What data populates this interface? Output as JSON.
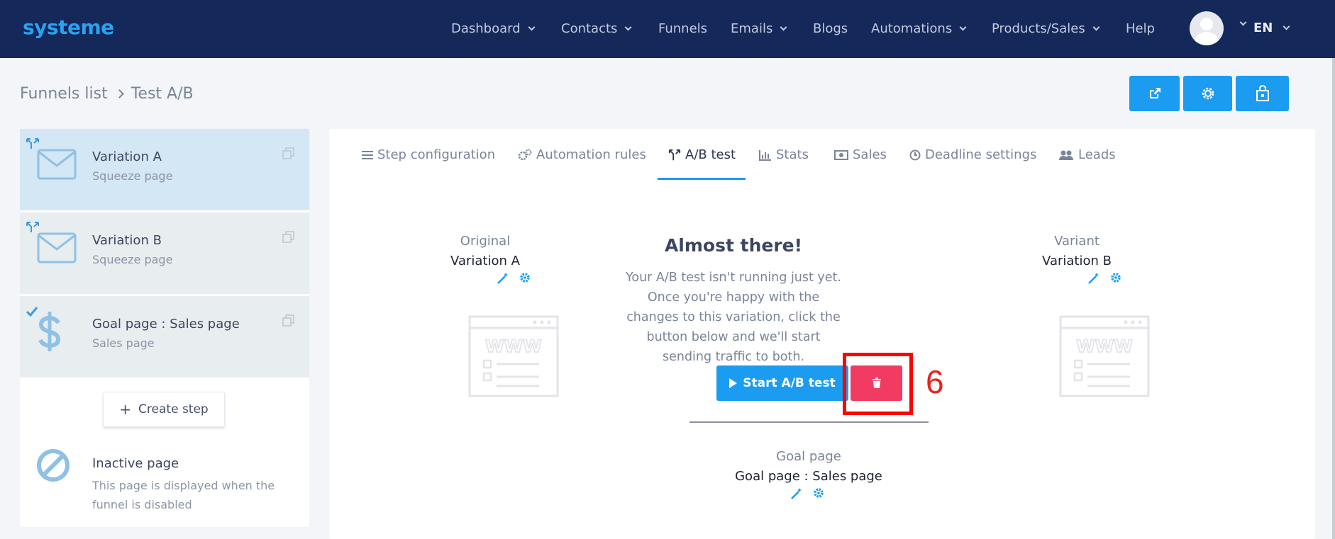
{
  "app": {
    "logo": "systeme"
  },
  "nav": {
    "items": [
      {
        "label": "Dashboard",
        "dropdown": true
      },
      {
        "label": "Contacts",
        "dropdown": true
      },
      {
        "label": "Funnels",
        "dropdown": false
      },
      {
        "label": "Emails",
        "dropdown": true
      },
      {
        "label": "Blogs",
        "dropdown": false
      },
      {
        "label": "Automations",
        "dropdown": true
      },
      {
        "label": "Products/Sales",
        "dropdown": true
      },
      {
        "label": "Help",
        "dropdown": false
      }
    ],
    "language": "EN"
  },
  "breadcrumb": {
    "parent": "Funnels list",
    "current": "Test A/B"
  },
  "top_actions": [
    "external-link-icon",
    "gear-icon",
    "shopping-bag-icon"
  ],
  "sidebar": {
    "steps": [
      {
        "title": "Variation A",
        "subtitle": "Squeeze page",
        "icon": "envelope-icon",
        "badge": "split-icon",
        "state": "active"
      },
      {
        "title": "Variation B",
        "subtitle": "Squeeze page",
        "icon": "envelope-icon",
        "badge": "split-icon",
        "state": "inactive"
      },
      {
        "title": "Goal page : Sales page",
        "subtitle": "Sales page",
        "icon": "dollar-icon",
        "badge": "check-icon",
        "state": "inactive"
      }
    ],
    "create_step": "Create step",
    "inactive_page": {
      "title": "Inactive page",
      "description": "This page is displayed when the funnel is disabled"
    }
  },
  "tabs": [
    {
      "label": "Step configuration",
      "icon": "list-icon"
    },
    {
      "label": "Automation rules",
      "icon": "gears-icon"
    },
    {
      "label": "A/B test",
      "icon": "split-icon",
      "active": true
    },
    {
      "label": "Stats",
      "icon": "bar-chart-icon"
    },
    {
      "label": "Sales",
      "icon": "money-icon"
    },
    {
      "label": "Deadline settings",
      "icon": "clock-icon"
    },
    {
      "label": "Leads",
      "icon": "users-icon"
    }
  ],
  "ab_test": {
    "original_label": "Original",
    "original_name": "Variation A",
    "variant_label": "Variant",
    "variant_name": "Variation B",
    "heading": "Almost there!",
    "explanation": "Your A/B test isn't running just yet. Once you're happy with the changes to this variation, click the button below and we'll start sending traffic to both.",
    "start_button": "Start A/B test",
    "goal_label": "Goal page",
    "goal_name": "Goal page : Sales page"
  },
  "annotation": "6",
  "colors": {
    "navbar": "#14285a",
    "primary": "#1b9cf0",
    "danger": "#f23b62",
    "highlight": "#ff0000"
  }
}
